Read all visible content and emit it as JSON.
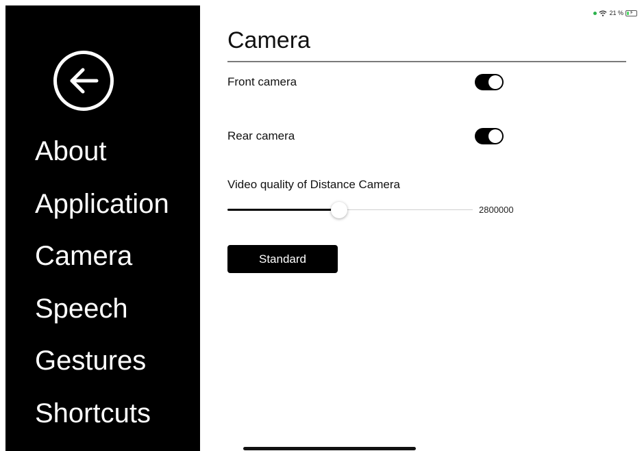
{
  "status_bar": {
    "battery_text": "21 %",
    "battery_level": 0.21,
    "dot_color": "#2bb24c",
    "icons": [
      "status-dot",
      "wifi-icon",
      "battery-charging-icon"
    ]
  },
  "sidebar": {
    "back_icon": "arrow-left-circle-icon",
    "items": [
      {
        "label": "About"
      },
      {
        "label": "Application"
      },
      {
        "label": "Camera"
      },
      {
        "label": "Speech"
      },
      {
        "label": "Gestures"
      },
      {
        "label": "Shortcuts"
      }
    ]
  },
  "main": {
    "title": "Camera",
    "front_camera": {
      "label": "Front camera",
      "on": true
    },
    "rear_camera": {
      "label": "Rear camera",
      "on": true
    },
    "video_quality": {
      "label": "Video quality of Distance Camera",
      "value_text": "2800000",
      "fraction": 0.455
    },
    "standard_button": "Standard"
  }
}
